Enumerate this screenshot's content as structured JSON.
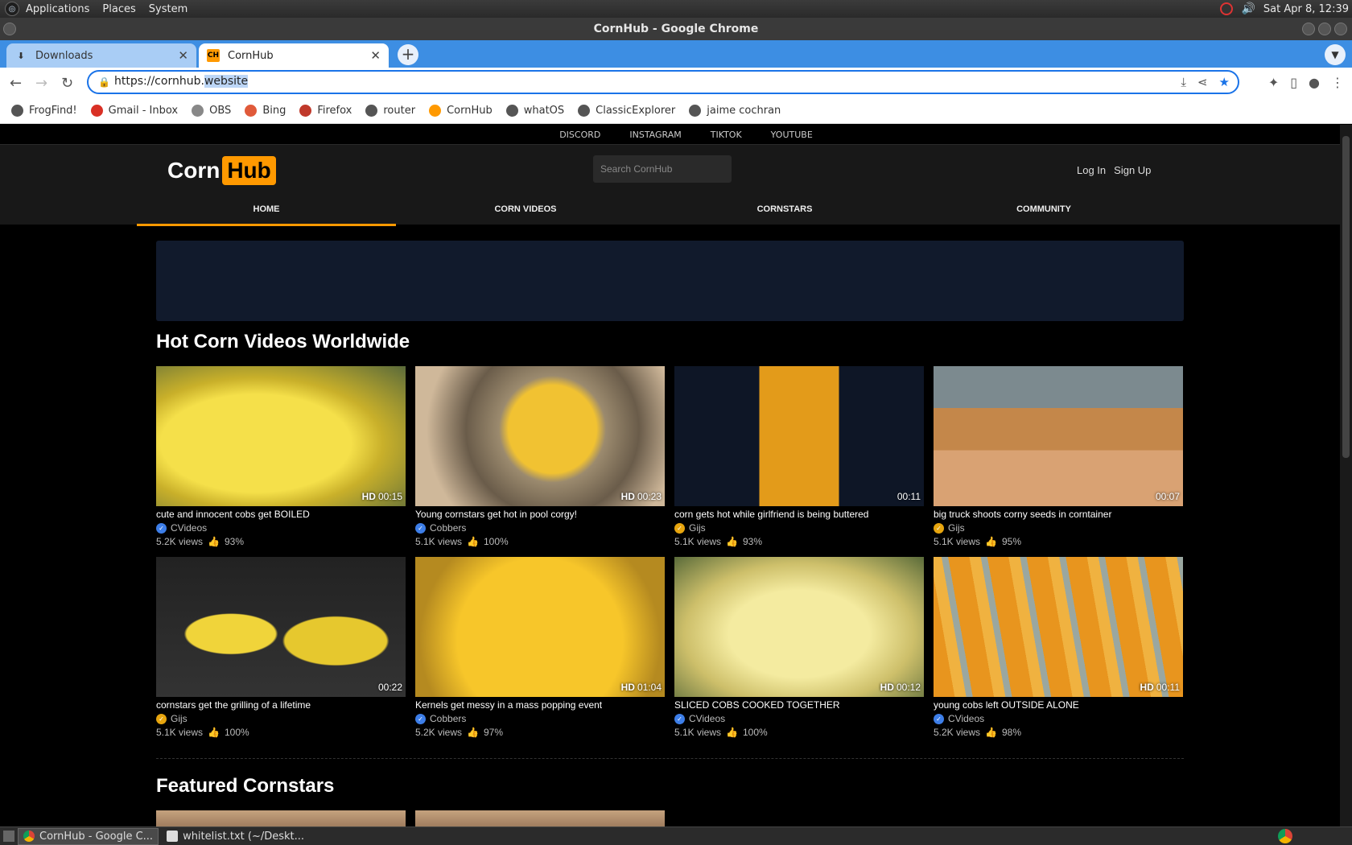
{
  "top_panel": {
    "menus": [
      "Applications",
      "Places",
      "System"
    ],
    "clock": "Sat Apr  8, 12:39"
  },
  "window": {
    "title": "CornHub - Google Chrome"
  },
  "tabs": [
    {
      "label": "Downloads",
      "active": false
    },
    {
      "label": "CornHub",
      "active": true
    }
  ],
  "omnibox": {
    "scheme_host": "https://cornhub.",
    "selected": "website"
  },
  "bookmarks": [
    {
      "label": "FrogFind!",
      "color": "#555555"
    },
    {
      "label": "Gmail - Inbox",
      "color": "#d93025"
    },
    {
      "label": "OBS",
      "color": "#888888"
    },
    {
      "label": "Bing",
      "color": "#e05a3a"
    },
    {
      "label": "Firefox",
      "color": "#c0392b"
    },
    {
      "label": "router",
      "color": "#555555"
    },
    {
      "label": "CornHub",
      "color": "#ff9900"
    },
    {
      "label": "whatOS",
      "color": "#555555"
    },
    {
      "label": "ClassicExplorer",
      "color": "#555555"
    },
    {
      "label": "jaime cochran",
      "color": "#555555"
    }
  ],
  "site": {
    "social": [
      "DISCORD",
      "INSTAGRAM",
      "TIKTOK",
      "YOUTUBE"
    ],
    "logo": {
      "left": "Corn",
      "right": "Hub"
    },
    "search_placeholder": "Search CornHub",
    "login": "Log In",
    "signup": "Sign Up",
    "nav": [
      "HOME",
      "CORN VIDEOS",
      "CORNSTARS",
      "COMMUNITY"
    ],
    "accent": "#ff9900",
    "section_title": "Hot Corn Videos Worldwide",
    "featured_title": "Featured Cornstars",
    "videos": [
      {
        "title": "cute and innocent cobs get BOILED",
        "channel": "CVideos",
        "badge": "blue",
        "views": "5.2K views",
        "rating": "93%",
        "hd": "HD",
        "duration": "00:15",
        "thumb": "boiled"
      },
      {
        "title": "Young cornstars get hot in pool corgy!",
        "channel": "Cobbers",
        "badge": "blue",
        "views": "5.1K views",
        "rating": "100%",
        "hd": "HD",
        "duration": "00:23",
        "thumb": "pot"
      },
      {
        "title": "corn gets hot while girlfriend is being buttered",
        "channel": "Gijs",
        "badge": "gold",
        "views": "5.1K views",
        "rating": "93%",
        "hd": "",
        "duration": "00:11",
        "thumb": "grilled"
      },
      {
        "title": "big truck shoots corny seeds in corntainer",
        "channel": "Gijs",
        "badge": "gold",
        "views": "5.1K views",
        "rating": "95%",
        "hd": "",
        "duration": "00:07",
        "thumb": "seeds"
      },
      {
        "title": "cornstars get the grilling of a lifetime",
        "channel": "Gijs",
        "badge": "gold",
        "views": "5.1K views",
        "rating": "100%",
        "hd": "",
        "duration": "00:22",
        "thumb": "grill"
      },
      {
        "title": "Kernels get messy in a mass popping event",
        "channel": "Cobbers",
        "badge": "blue",
        "views": "5.2K views",
        "rating": "97%",
        "hd": "HD",
        "duration": "01:04",
        "thumb": "kernels"
      },
      {
        "title": "SLICED COBS COOKED TOGETHER",
        "channel": "CVideos",
        "badge": "blue",
        "views": "5.1K views",
        "rating": "100%",
        "hd": "HD",
        "duration": "00:12",
        "thumb": "sliced"
      },
      {
        "title": "young cobs left OUTSIDE ALONE",
        "channel": "CVideos",
        "badge": "blue",
        "views": "5.2K views",
        "rating": "98%",
        "hd": "HD",
        "duration": "00:11",
        "thumb": "hanging"
      }
    ]
  },
  "taskbar": [
    {
      "label": "CornHub - Google C...",
      "active": true
    },
    {
      "label": "whitelist.txt (~/Deskt...",
      "active": false
    }
  ]
}
